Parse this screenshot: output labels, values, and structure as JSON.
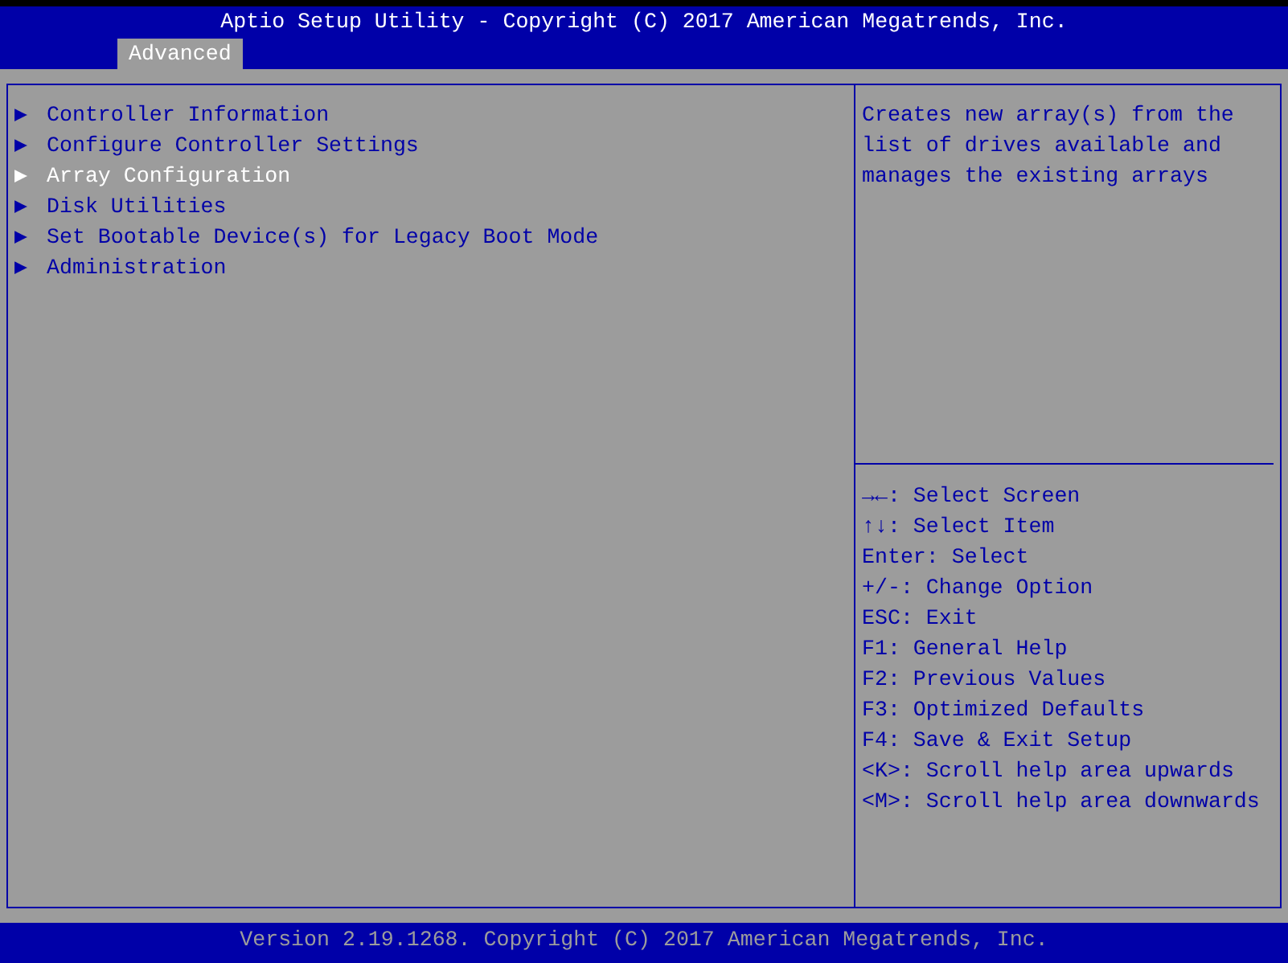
{
  "header": {
    "title": "Aptio Setup Utility - Copyright (C) 2017 American Megatrends, Inc."
  },
  "tabs": [
    {
      "label": "Advanced",
      "selected": true
    }
  ],
  "menu_items": [
    {
      "marker": "▶",
      "label": "Controller Information",
      "selected": false
    },
    {
      "marker": "▶",
      "label": "Configure Controller Settings",
      "selected": false
    },
    {
      "marker": "▶",
      "label": "Array Configuration",
      "selected": true
    },
    {
      "marker": "▶",
      "label": "Disk Utilities",
      "selected": false
    },
    {
      "marker": "▶",
      "label": "Set Bootable Device(s) for Legacy Boot Mode",
      "selected": false
    },
    {
      "marker": "▶",
      "label": "Administration",
      "selected": false
    }
  ],
  "help_text": "Creates new array(s) from the list of drives available and manages the existing arrays",
  "key_help": [
    {
      "key": "→←",
      "action": ": Select Screen"
    },
    {
      "key": "↑↓",
      "action": ": Select Item"
    },
    {
      "key": "Enter",
      "action": ": Select"
    },
    {
      "key": "+/-",
      "action": ": Change Option"
    },
    {
      "key": "ESC",
      "action": ": Exit"
    },
    {
      "key": "F1",
      "action": ": General Help"
    },
    {
      "key": "F2",
      "action": ": Previous Values"
    },
    {
      "key": "F3",
      "action": ": Optimized Defaults"
    },
    {
      "key": "F4",
      "action": ": Save & Exit Setup"
    },
    {
      "key": "<K>",
      "action": ": Scroll help area upwards"
    },
    {
      "key": "<M>",
      "action": ": Scroll help area downwards"
    }
  ],
  "footer": {
    "text": "Version 2.19.1268. Copyright (C) 2017 American Megatrends, Inc."
  }
}
